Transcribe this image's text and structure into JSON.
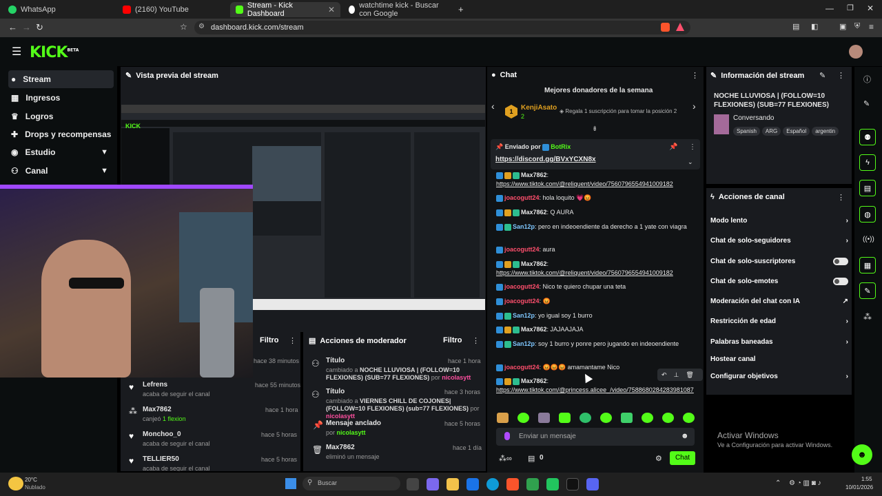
{
  "browser": {
    "tabs": [
      {
        "label": "WhatsApp"
      },
      {
        "label": "(2160) YouTube"
      },
      {
        "label": "Stream - Kick Dashboard"
      },
      {
        "label": "watchtime kick - Buscar con Google"
      }
    ],
    "url": "dashboard.kick.com/stream"
  },
  "kick": {
    "logo": "KICK",
    "beta": "BETA"
  },
  "sidebar": {
    "items": [
      {
        "label": "Stream"
      },
      {
        "label": "Ingresos"
      },
      {
        "label": "Logros"
      },
      {
        "label": "Drops y recompensas"
      },
      {
        "label": "Estudio"
      },
      {
        "label": "Canal"
      }
    ]
  },
  "preview": {
    "title": "Vista previa del stream"
  },
  "followers_panel": {
    "title": "Filtro",
    "first_time": "hace 38 minutos",
    "events": [
      {
        "user": "Lefrens",
        "action": "acaba de seguir el canal",
        "time": "hace 55 minutos"
      },
      {
        "user": "Max7862",
        "action": "canjeó",
        "extra": "1 flexion",
        "time": "hace 1 hora"
      },
      {
        "user": "Monchoo_0",
        "action": "acaba de seguir el canal",
        "time": "hace 5 horas"
      },
      {
        "user": "TELLIER50",
        "action": "acaba de seguir el canal",
        "time": "hace 5 horas"
      }
    ]
  },
  "mod_actions": {
    "title": "Acciones de moderador",
    "filter": "Filtro",
    "items": [
      {
        "title": "Título",
        "time": "hace 1 hora",
        "text1": "cambiado a ",
        "bold": "NOCHE LLUVIOSA | (FOLLOW=10 FLEXIONES) (SUB=77 FLEXIONES)",
        "by": " por ",
        "user": "nicolasytt"
      },
      {
        "title": "Título",
        "time": "hace 3 horas",
        "text1": "cambiado a ",
        "bold": "VIERNES CHILL DE COJONES| (FOLLOW=10 FLEXIONES) (sub=77 FLEXIONES)",
        "by": " por ",
        "user": "nicolasytt"
      },
      {
        "title": "Mensaje anclado",
        "time": "hace 5 horas",
        "text1": "",
        "bold": "",
        "by": "por ",
        "user": "nicolasytt"
      },
      {
        "title": "Max7862",
        "time": "hace 1 día",
        "text1": "eliminó un mensaje",
        "bold": "",
        "by": "",
        "user": ""
      }
    ]
  },
  "chat": {
    "title": "Chat",
    "donors_title": "Mejores donadores de la semana",
    "donor": {
      "rank": "1",
      "name": "KenjiAsato",
      "count": "2",
      "promo": "Regala 1 suscripción para tomar la posición 2"
    },
    "pinned": {
      "label": "Enviado por",
      "user": "BotRix",
      "link": "https://discord.gg/BVxYCXN8x"
    },
    "messages": [
      {
        "user": "Max7862",
        "uclass": "u1",
        "text": "",
        "link": "https://www.tiktok.com/@reliquent/video/7560796554941009182"
      },
      {
        "user": "joacogutt24",
        "uclass": "u3",
        "text": "hola loquito 💗😡",
        "link": ""
      },
      {
        "user": "Max7862",
        "uclass": "u1",
        "text": "Q AURA",
        "link": ""
      },
      {
        "user": "San12p",
        "uclass": "u2",
        "text": "pero en indeoendiente da derecho a 1 yate con viagra",
        "link": ""
      },
      {
        "user": "joacogutt24",
        "uclass": "u3",
        "text": "aura",
        "link": ""
      },
      {
        "user": "Max7862",
        "uclass": "u1",
        "text": "",
        "link": "https://www.tiktok.com/@reliquent/video/7560796554941009182"
      },
      {
        "user": "joacogutt24",
        "uclass": "u3",
        "text": "Nico te quiero chupar una teta",
        "link": ""
      },
      {
        "user": "joacogutt24",
        "uclass": "u3",
        "text": "😡",
        "link": ""
      },
      {
        "user": "San12p",
        "uclass": "u2",
        "text": "yo igual soy 1 burro",
        "link": ""
      },
      {
        "user": "Max7862",
        "uclass": "u1",
        "text": "JAJAAJAJA",
        "link": ""
      },
      {
        "user": "San12p",
        "uclass": "u2",
        "text": "soy 1 burro y ponre pero jugando en indeoendiente",
        "link": ""
      },
      {
        "user": "joacogutt24",
        "uclass": "u3",
        "text": "😡😡😡 amamantame Nico",
        "link": ""
      },
      {
        "user": "Max7862",
        "uclass": "u1",
        "text": "",
        "link": "https://www.tiktok.com/@princess.alicee_/video/7588680284283981087"
      }
    ],
    "input_placeholder": "Enviar un mensaje",
    "points": "0",
    "send": "Chat"
  },
  "stream_info": {
    "title": "Información del stream",
    "stream_title": "NOCHE LLUVIOSA | (FOLLOW=10 FLEXIONES) (SUB=77 FLEXIONES)",
    "category": "Conversando",
    "tags": [
      "Spanish",
      "ARG",
      "Español",
      "argentin"
    ]
  },
  "channel_actions": {
    "title": "Acciones de canal",
    "items": [
      {
        "label": "Modo lento",
        "kind": "arrow"
      },
      {
        "label": "Chat de solo-seguidores",
        "kind": "arrow"
      },
      {
        "label": "Chat de solo-suscriptores",
        "kind": "toggle"
      },
      {
        "label": "Chat de solo-emotes",
        "kind": "toggle"
      },
      {
        "label": "Moderación del chat con IA",
        "kind": "ext"
      },
      {
        "label": "Restricción de edad",
        "kind": "arrow"
      },
      {
        "label": "Palabras baneadas",
        "kind": "arrow"
      },
      {
        "label": "Hostear canal",
        "kind": "none"
      },
      {
        "label": "Configurar objetivos",
        "kind": "arrow"
      }
    ]
  },
  "windows_watermark": {
    "line1": "Activar Windows",
    "line2": "Ve a Configuración para activar Windows."
  },
  "taskbar": {
    "weather_temp": "20°C",
    "weather_text": "Nublado",
    "search": "Buscar",
    "time": "1:55",
    "date": "10/01/2026"
  },
  "colors": {
    "kick_green": "#53fc18",
    "panel": "#191b1f",
    "bg": "#0b0e0f"
  }
}
